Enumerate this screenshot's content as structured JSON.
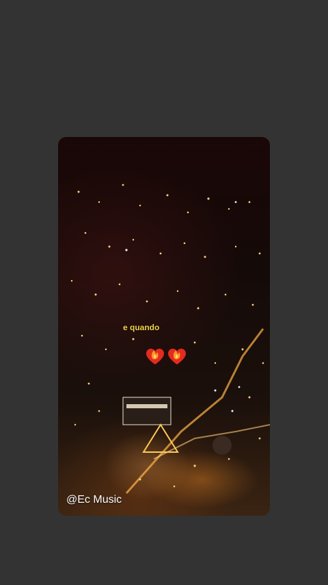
{
  "story": {
    "caption": "e quando",
    "reaction_icons": [
      "heart-on-fire-icon",
      "heart-on-fire-icon"
    ],
    "watermark": "@Ec Music"
  },
  "colors": {
    "page_background": "#333333",
    "caption_text": "#f2d34a",
    "heart_red": "#e52a1f",
    "flame_orange": "#ff9a2a"
  }
}
